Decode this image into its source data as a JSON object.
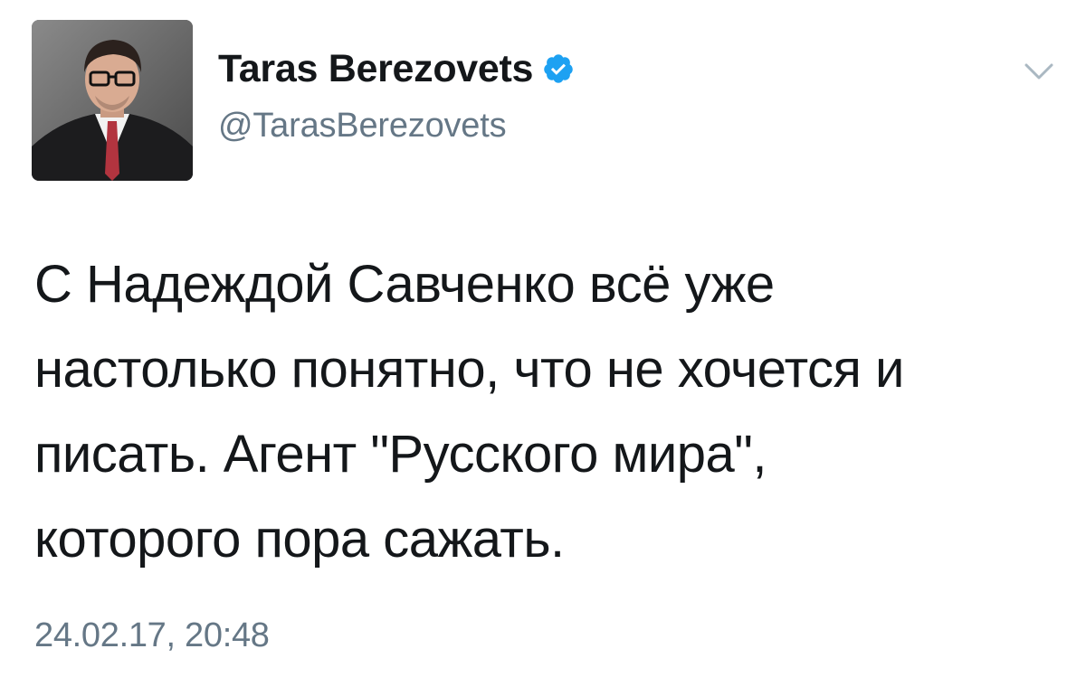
{
  "user": {
    "display_name": "Taras Berezovets",
    "handle": "@TarasBerezovets",
    "verified": true,
    "verified_color": "#1da1f2"
  },
  "tweet": {
    "text": "С Надеждой Савченко всё уже\nнастолько понятно, что не хочется и\nписать. Агент \"Русского мира\",\nкоторого пора сажать.",
    "timestamp": "24.02.17, 20:48"
  },
  "icons": {
    "verified": "verified-badge-icon",
    "menu": "chevron-down-icon"
  },
  "colors": {
    "text": "#14171a",
    "secondary": "#657786",
    "chevron": "#aab8c2"
  }
}
